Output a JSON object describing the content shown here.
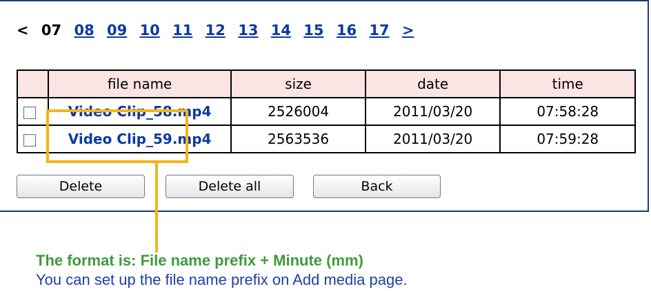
{
  "pager": {
    "prev": "<",
    "current": "07",
    "pages": [
      "08",
      "09",
      "10",
      "11",
      "12",
      "13",
      "14",
      "15",
      "16",
      "17"
    ],
    "next": ">"
  },
  "table": {
    "headers": [
      "file name",
      "size",
      "date",
      "time"
    ],
    "rows": [
      {
        "file_name": "Video Clip_58.mp4",
        "size": "2526004",
        "date": "2011/03/20",
        "time": "07:58:28"
      },
      {
        "file_name": "Video Clip_59.mp4",
        "size": "2563536",
        "date": "2011/03/20",
        "time": "07:59:28"
      }
    ]
  },
  "buttons": {
    "delete": "Delete",
    "delete_all": "Delete all",
    "back": "Back"
  },
  "annotation": {
    "format_note": "The format is: File name prefix + Minute (mm)",
    "setup_note": "You can set up the file name prefix on Add media page.",
    "highlight_color": "#f5b31b",
    "note_color": "#3f9a3a",
    "setup_color": "#1f3fa8"
  }
}
